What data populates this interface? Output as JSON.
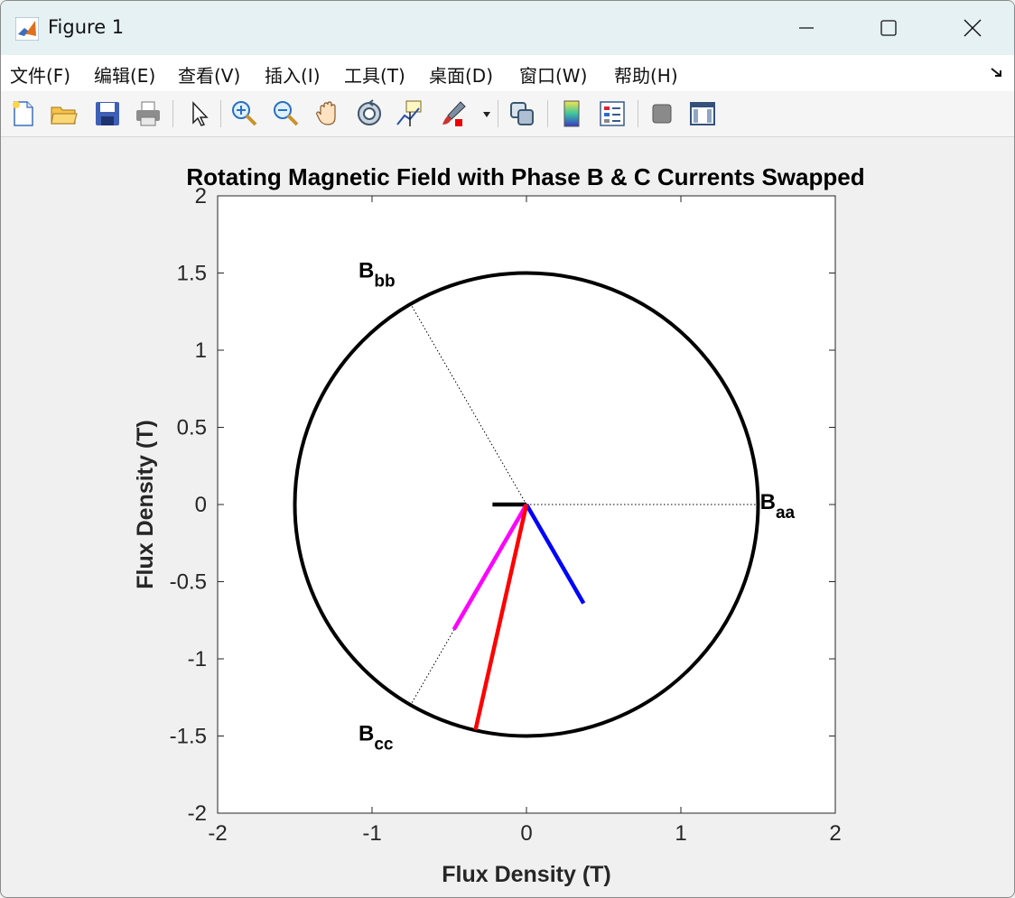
{
  "window": {
    "title": "Figure 1"
  },
  "menu": [
    {
      "label": "文件(F)"
    },
    {
      "label": "编辑(E)"
    },
    {
      "label": "查看(V)"
    },
    {
      "label": "插入(I)"
    },
    {
      "label": "工具(T)"
    },
    {
      "label": "桌面(D)"
    },
    {
      "label": "窗口(W)"
    },
    {
      "label": "帮助(H)"
    }
  ],
  "toolbar": {
    "icons": [
      "new-figure-icon",
      "open-file-icon",
      "save-icon",
      "print-icon",
      "select-arrow-icon",
      "zoom-in-icon",
      "zoom-out-icon",
      "pan-hand-icon",
      "rotate-3d-icon",
      "data-cursor-icon",
      "brush-icon",
      "link-plot-icon",
      "colorbar-icon",
      "legend-icon",
      "hide-plot-tools-icon",
      "show-plot-tools-icon"
    ]
  },
  "chart_data": {
    "type": "line",
    "title": "Rotating Magnetic Field with Phase B & C Currents Swapped",
    "xlabel": "Flux Density (T)",
    "ylabel": "Flux Density (T)",
    "xlim": [
      -2,
      2
    ],
    "ylim": [
      -2,
      2
    ],
    "xticks": [
      "-2",
      "-1",
      "0",
      "1",
      "2"
    ],
    "yticks": [
      "2",
      "1.5",
      "1",
      "0.5",
      "0",
      "-0.5",
      "-1",
      "-1.5",
      "-2"
    ],
    "ytick_values": [
      2,
      1.5,
      1,
      0.5,
      0,
      -0.5,
      -1,
      -1.5,
      -2
    ],
    "xtick_values": [
      -2,
      -1,
      0,
      1,
      2
    ],
    "circle": {
      "radius": 1.5,
      "color": "#000000"
    },
    "dotted_axes": [
      {
        "to": [
          1.5,
          0
        ]
      },
      {
        "to": [
          -0.75,
          1.299
        ]
      },
      {
        "to": [
          -0.75,
          -1.299
        ]
      }
    ],
    "vectors": [
      {
        "to": [
          -0.22,
          0
        ],
        "color": "#000000"
      },
      {
        "to": [
          0.37,
          -0.64
        ],
        "color": "#0000ff"
      },
      {
        "to": [
          -0.47,
          -0.81
        ],
        "color": "#ff00ff"
      },
      {
        "to": [
          -0.33,
          -1.46
        ],
        "color": "#ff0000"
      }
    ],
    "annotations": [
      {
        "base": "B",
        "sub": "aa",
        "x": 1.6,
        "y": 0
      },
      {
        "base": "B",
        "sub": "bb",
        "x": -1.0,
        "y": 1.5
      },
      {
        "base": "B",
        "sub": "cc",
        "x": -1.0,
        "y": -1.5
      }
    ]
  }
}
